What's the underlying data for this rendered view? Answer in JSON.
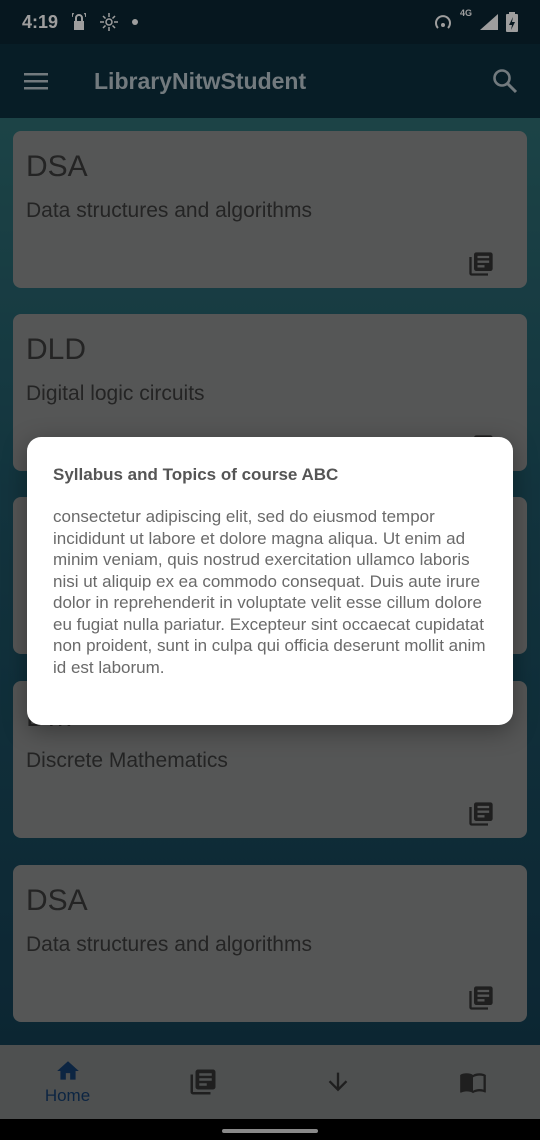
{
  "status_bar": {
    "time": "4:19",
    "network_label": "4G"
  },
  "app_bar": {
    "title": "LibraryNitwStudent"
  },
  "cards": [
    {
      "code": "DSA",
      "description": "Data structures and algorithms"
    },
    {
      "code": "DLD",
      "description": "Digital logic circuits"
    },
    {
      "code": "",
      "description": ""
    },
    {
      "code": "DM",
      "description": "Discrete Mathematics"
    },
    {
      "code": "DSA",
      "description": "Data structures and algorithms"
    }
  ],
  "dialog": {
    "title": "Syllabus and Topics of course ABC",
    "body": "consectetur adipiscing elit, sed do eiusmod tempor incididunt ut labore et dolore magna aliqua. Ut enim ad minim veniam, quis nostrud exercitation ullamco laboris nisi ut aliquip ex ea commodo consequat. Duis aute irure dolor in reprehenderit in voluptate velit esse cillum dolore eu fugiat nulla pariatur. Excepteur sint occaecat cupidatat non proident, sunt in culpa qui officia deserunt mollit anim id est laborum."
  },
  "bottom_nav": {
    "items": [
      {
        "label": "Home",
        "icon": "home-icon",
        "selected": true
      },
      {
        "label": "",
        "icon": "library-books-icon",
        "selected": false
      },
      {
        "label": "",
        "icon": "arrow-down-icon",
        "selected": false
      },
      {
        "label": "",
        "icon": "open-book-icon",
        "selected": false
      }
    ]
  },
  "colors": {
    "app_bar": "#0c2f3e",
    "card": "#8a8c8c",
    "nav_selected": "#143c6b"
  }
}
